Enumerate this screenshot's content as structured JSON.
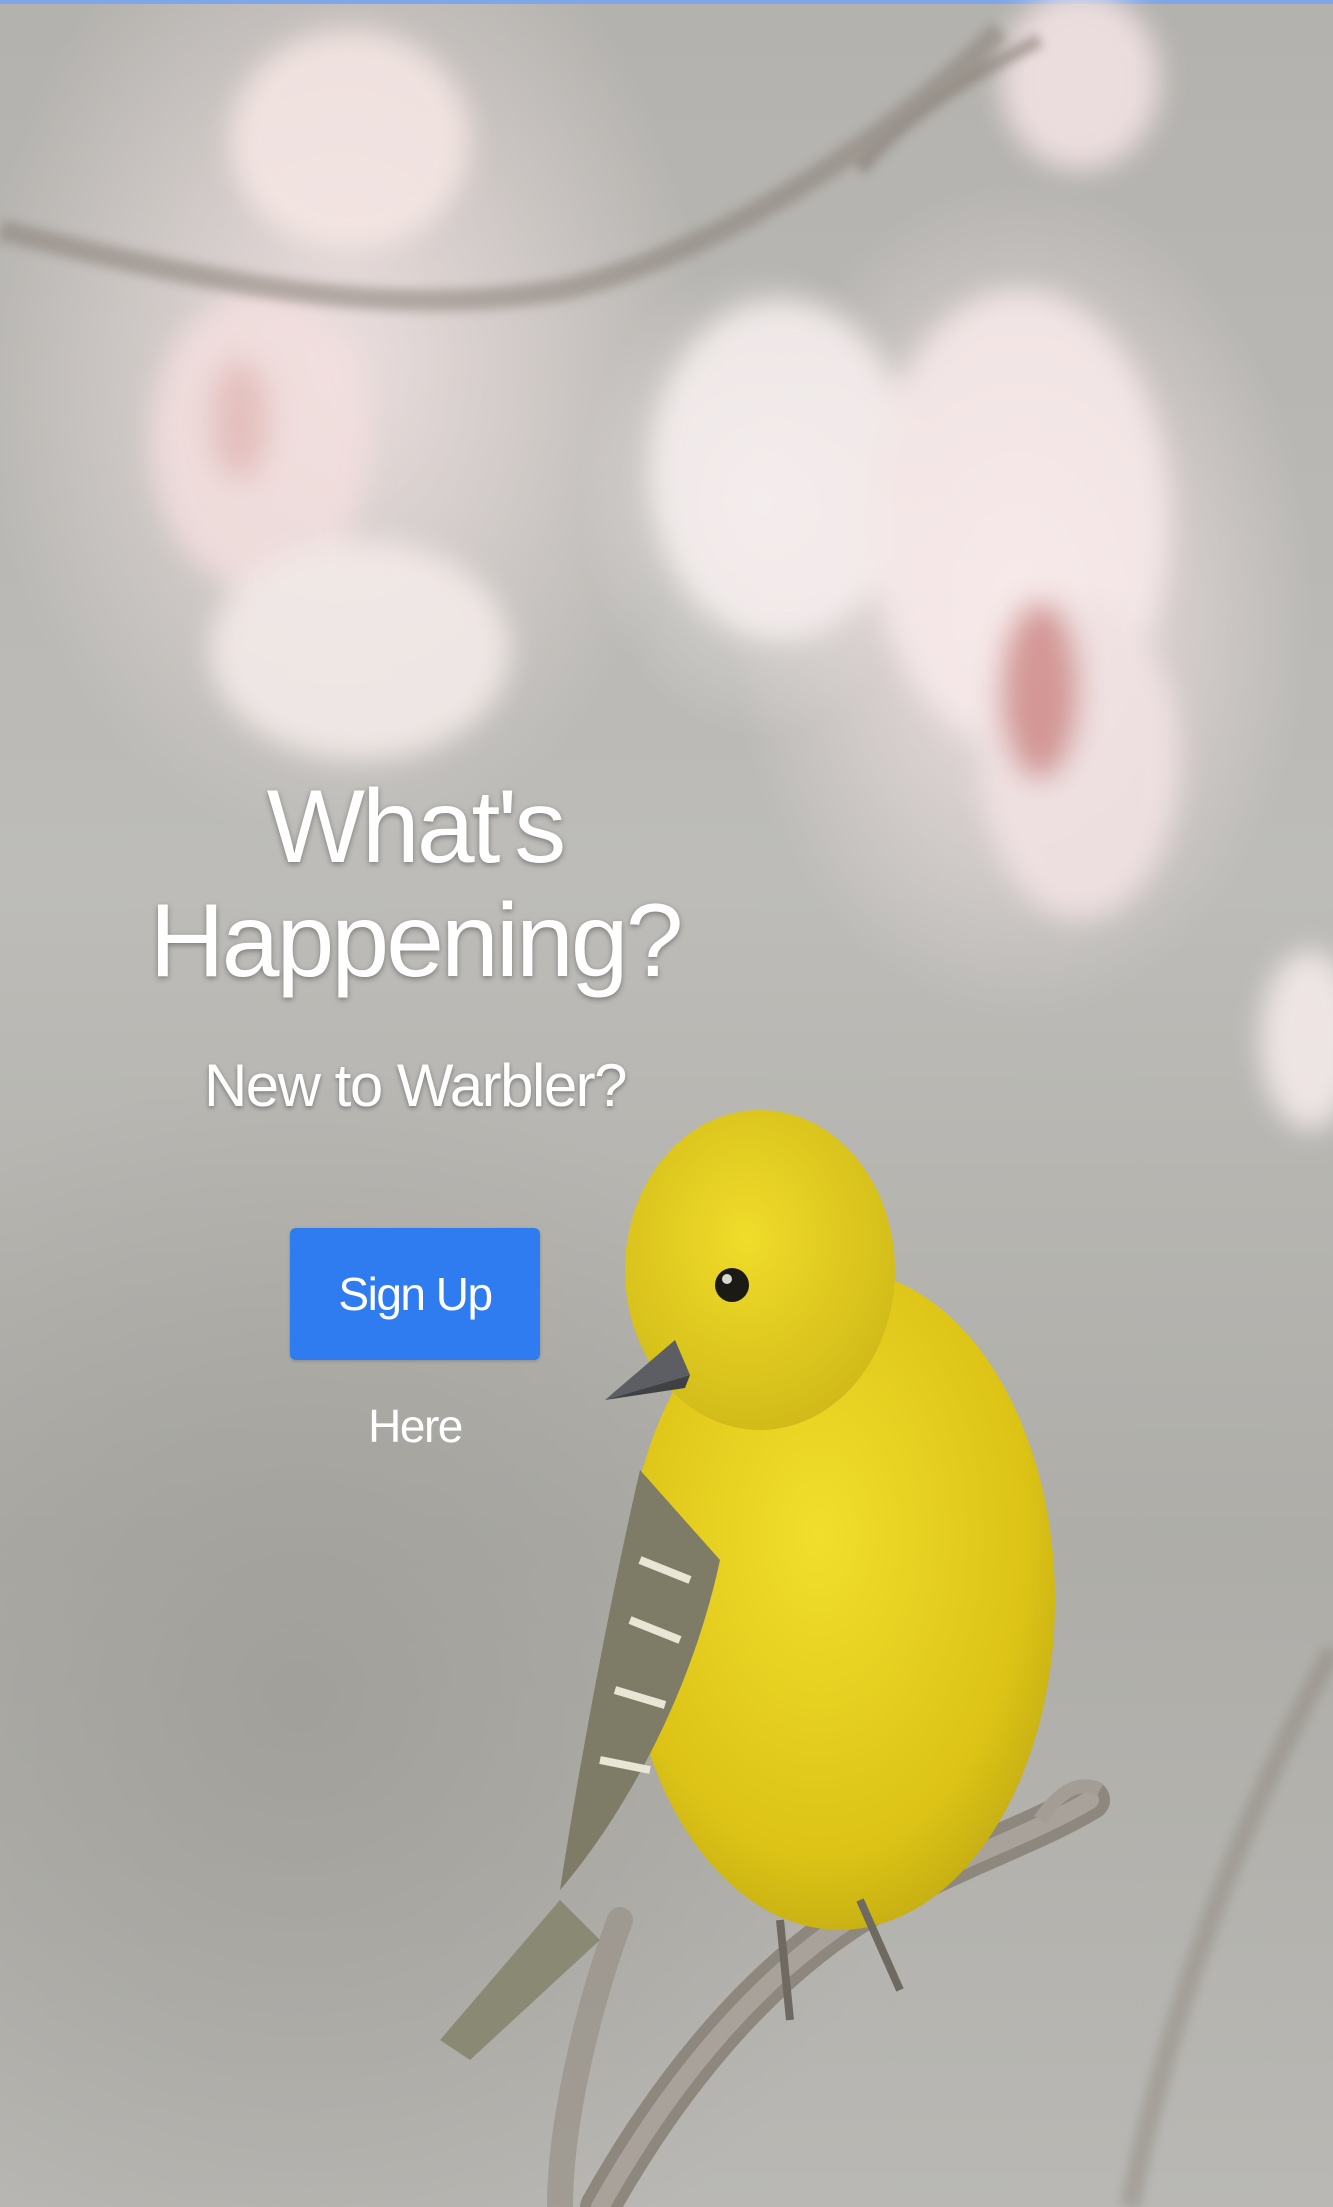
{
  "hero": {
    "title": "What's Happening?",
    "subtitle": "New to Warbler?",
    "signup_label": "Sign Up Here"
  },
  "colors": {
    "accent": "#2f7cf0",
    "bird_yellow": "#e8d21a"
  },
  "background_image": "yellow-warbler-on-branch"
}
